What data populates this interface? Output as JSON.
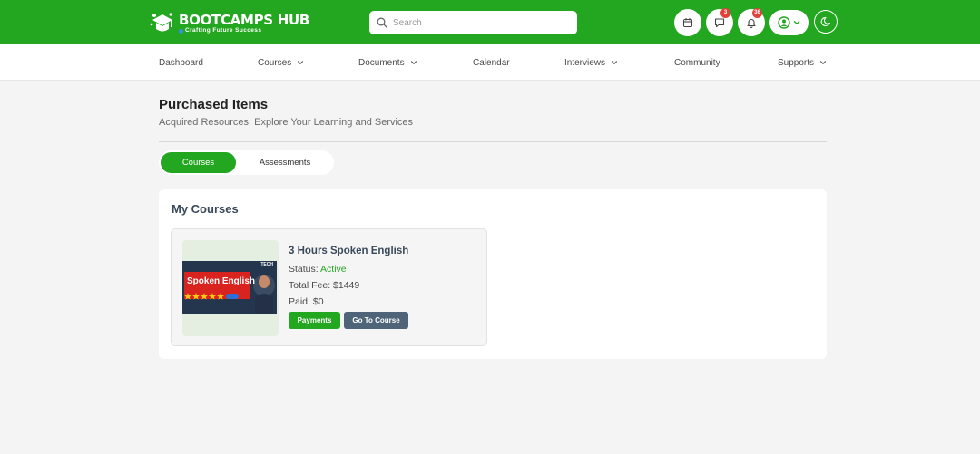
{
  "brand": {
    "name": "BOOTCAMPS HUB",
    "tagline": "Crafting Future Success"
  },
  "search": {
    "placeholder": "Search"
  },
  "header": {
    "messages_badge": "3",
    "notifications_badge": "36"
  },
  "nav": {
    "items": [
      {
        "label": "Dashboard",
        "dropdown": false
      },
      {
        "label": "Courses",
        "dropdown": true
      },
      {
        "label": "Documents",
        "dropdown": true
      },
      {
        "label": "Calendar",
        "dropdown": false
      },
      {
        "label": "Interviews",
        "dropdown": true
      },
      {
        "label": "Community",
        "dropdown": false
      },
      {
        "label": "Supports",
        "dropdown": true
      }
    ]
  },
  "page": {
    "title": "Purchased Items",
    "subtitle": "Acquired Resources: Explore Your Learning and Services"
  },
  "tabs": [
    {
      "label": "Courses",
      "active": true
    },
    {
      "label": "Assessments",
      "active": false
    }
  ],
  "courses_panel": {
    "title": "My Courses",
    "course": {
      "name": "3 Hours Spoken English",
      "status_label": "Status:",
      "status_value": "Active",
      "fee_line": "Total Fee: $1449",
      "paid_line": "Paid: $0",
      "thumbnail_text": "Spoken English",
      "thumbnail_logo": "TECH",
      "payments_label": "Payments",
      "go_label": "Go To Course"
    }
  },
  "colors": {
    "brand_green": "#23a620",
    "slate_button": "#4f6478",
    "badge_red": "#e0413a"
  }
}
